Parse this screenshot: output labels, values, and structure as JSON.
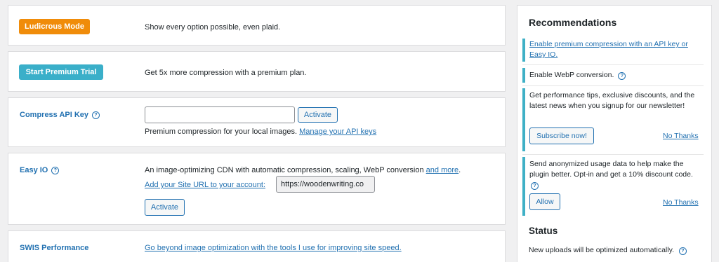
{
  "rows": {
    "ludicrous": {
      "button": "Ludicrous Mode",
      "description": "Show every option possible, even plaid."
    },
    "premium": {
      "button": "Start Premium Trial",
      "description": "Get 5x more compression with a premium plan."
    },
    "api_key": {
      "label": "Compress API Key",
      "input_value": "",
      "activate": "Activate",
      "description": "Premium compression for your local images.",
      "manage_link": "Manage your API keys"
    },
    "easy_io": {
      "label": "Easy IO",
      "description": "An image-optimizing CDN with automatic compression, scaling, WebP conversion",
      "more_link": "and more",
      "period": ".",
      "site_link": "Add your Site URL to your account:",
      "site_url": "https://woodenwriting.co",
      "activate": "Activate"
    },
    "swis": {
      "label": "SWIS Performance",
      "link": "Go beyond image optimization with the tools I use for improving site speed."
    }
  },
  "sidebar": {
    "title": "Recommendations",
    "items": [
      {
        "link": "Enable premium compression with an API key or Easy IO."
      },
      {
        "text": "Enable WebP conversion."
      },
      {
        "text": "Get performance tips, exclusive discounts, and the latest news when you signup for our newsletter!",
        "primary": "Subscribe now!",
        "secondary": "No Thanks"
      },
      {
        "text": "Send anonymized usage data to help make the plugin better. Opt-in and get a 10% discount code.",
        "primary": "Allow",
        "secondary": "No Thanks"
      }
    ],
    "status_title": "Status",
    "status_text": "New uploads will be optimized automatically."
  },
  "colors": {
    "orange": "#f08c0a",
    "teal": "#3aafc9",
    "link": "#2271b1"
  },
  "icons": {
    "help": "help-circle-icon"
  }
}
